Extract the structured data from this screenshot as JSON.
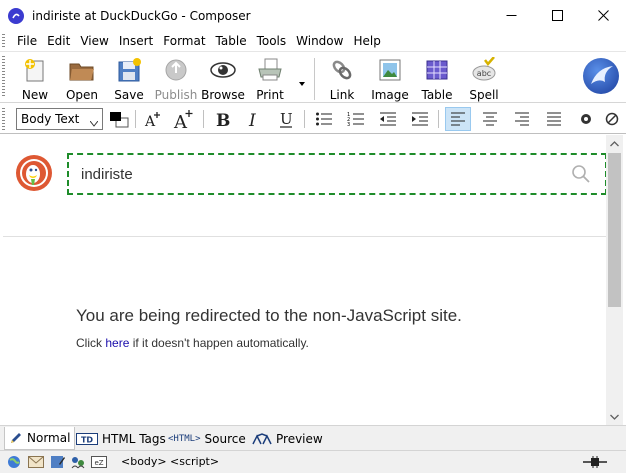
{
  "window": {
    "title": "indiriste at DuckDuckGo - Composer"
  },
  "menu": [
    "File",
    "Edit",
    "View",
    "Insert",
    "Format",
    "Table",
    "Tools",
    "Window",
    "Help"
  ],
  "toolbar": {
    "new": "New",
    "open": "Open",
    "save": "Save",
    "publish": "Publish",
    "browse": "Browse",
    "print": "Print",
    "link": "Link",
    "image": "Image",
    "table": "Table",
    "spell": "Spell"
  },
  "format_toolbar": {
    "paragraph_format": "Body Text",
    "alignment": "left"
  },
  "content": {
    "search_value": "indiriste",
    "redirect_heading": "You are being redirected to the non-JavaScript site.",
    "click_prefix": "Click ",
    "here_link": "here",
    "click_suffix": " if it doesn't happen automatically."
  },
  "mode_tabs": {
    "normal": "Normal",
    "html_tags": "HTML Tags",
    "source_prefix": "<HTML>",
    "source": "Source",
    "preview": "Preview",
    "active": "Normal"
  },
  "status": {
    "tags": [
      "<body>",
      "<script>"
    ]
  },
  "colors": {
    "accent": "#1e8c2a",
    "ddg_brand": "#de5833",
    "link": "#1a0dab",
    "selection": "#cce4f7"
  },
  "icons": [
    "app-icon",
    "new-icon",
    "open-icon",
    "save-icon",
    "publish-icon",
    "browse-icon",
    "print-icon",
    "link-icon",
    "image-icon",
    "table-icon",
    "spell-icon",
    "seamonkey-logo"
  ]
}
